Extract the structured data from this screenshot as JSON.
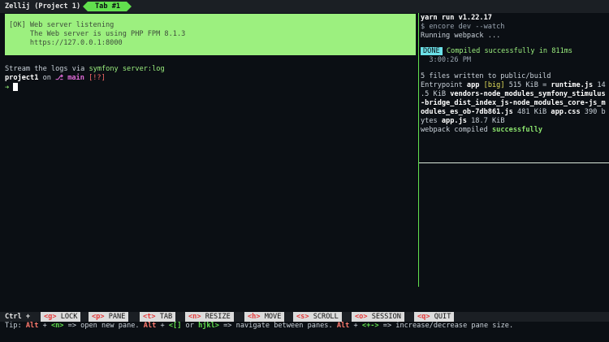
{
  "topbar": {
    "session": "Zellij (Project 1)",
    "tab": "Tab #1"
  },
  "left": {
    "ok_lines": [
      "[OK] Web server listening",
      "     The Web server is using PHP FPM 8.1.3",
      "     https://127.0.0.1:8000"
    ],
    "stream_prefix": "Stream the logs via ",
    "stream_cmd": "symfony server:log",
    "prompt_dir": "project1",
    "prompt_on": " on ",
    "prompt_branch_icon": "⎇",
    "prompt_branch": " main",
    "prompt_status": " [!?]",
    "prompt_arrow": "➜"
  },
  "right": {
    "yarn": "yarn run v1.22.17",
    "cmd": "$ encore dev --watch",
    "running": "Running webpack ...",
    "done": "DONE",
    "compiled": " Compiled successfully in 811ms",
    "time": "  3:00:26 PM",
    "files_written": "5 files written to public/build",
    "entry_lines": [
      "Entrypoint app [big] 515 KiB = runtime.js 14",
      ".5 KiB vendors-node_modules_symfony_stimulus",
      "-bridge_dist_index_js-node_modules_core-js_m",
      "odules_es_ob-7db861.js 481 KiB app.css 390 b",
      "ytes app.js 18.7 KiB"
    ],
    "webpack_compiled": "webpack compiled ",
    "successfully": "successfully"
  },
  "keybar": {
    "ctrl": "Ctrl +",
    "keys": [
      {
        "key": "<g>",
        "label": " LOCK"
      },
      {
        "key": "<p>",
        "label": " PANE"
      },
      {
        "key": "<t>",
        "label": " TAB"
      },
      {
        "key": "<n>",
        "label": " RESIZE"
      },
      {
        "key": "<h>",
        "label": " MOVE"
      },
      {
        "key": "<s>",
        "label": " SCROLL"
      },
      {
        "key": "<o>",
        "label": " SESSION"
      },
      {
        "key": "<q>",
        "label": " QUIT"
      }
    ]
  },
  "tip": {
    "prefix": "Tip: ",
    "alt1": "Alt",
    "plus1": " + ",
    "n": "<n>",
    "t1": " => open new pane. ",
    "alt2": "Alt",
    "plus2": " + ",
    "bracket": "<[]",
    "or": " or ",
    "hjkl": "hjkl>",
    "t2": " => navigate between panes. ",
    "alt3": "Alt",
    "plus3": " + ",
    "arrows": "<+->",
    "t3": " => increase/decrease pane size."
  },
  "colors": {
    "accent": "#62e04e",
    "ok_bg": "#9cf07f",
    "done_bg": "#6ce1e8"
  }
}
